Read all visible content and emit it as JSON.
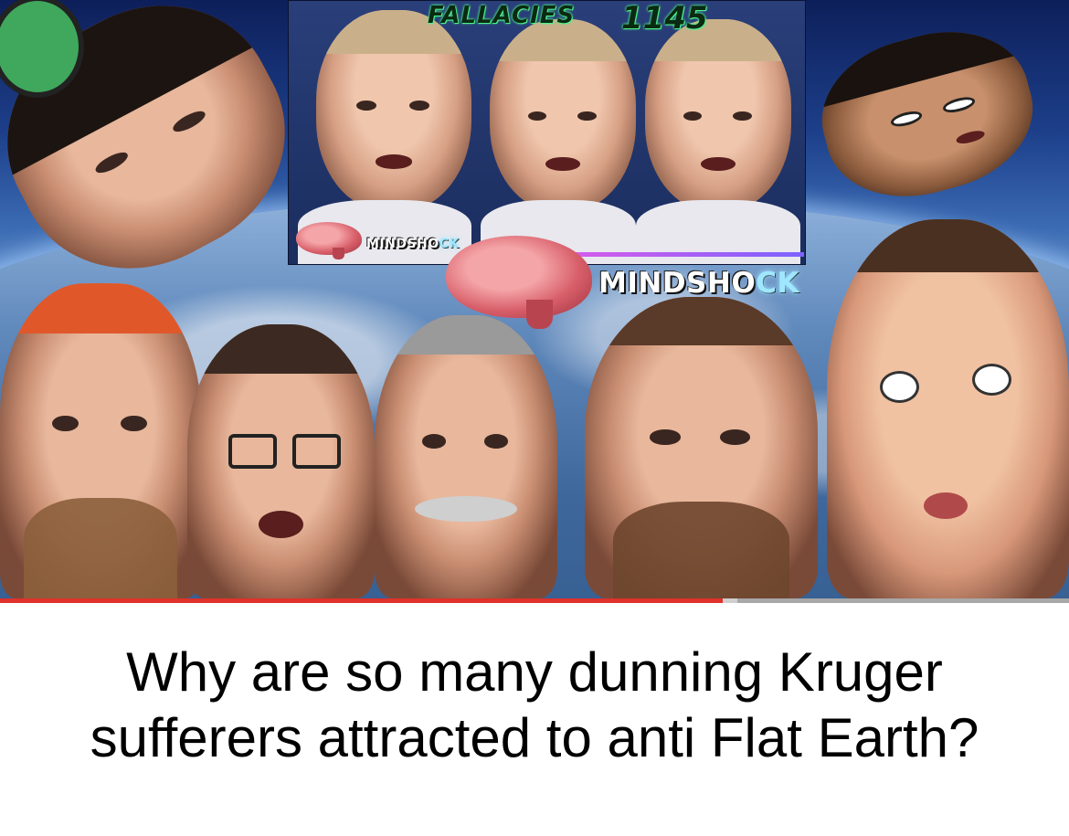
{
  "thumbnail": {
    "overlay_title_left": "FALLACIES",
    "overlay_title_number": "1145",
    "logo_small": {
      "text_main": "MINDSHO",
      "text_glitch": "CK"
    },
    "logo_large": {
      "text_main": "MINDSHO",
      "text_glitch": "CK"
    },
    "accent_colors": {
      "overlay_glow": "#4ef28a",
      "brain": "#d85f6a",
      "logo_bar": "#e05be8"
    }
  },
  "progress": {
    "played_fraction": 0.676,
    "buffered_fraction": 0.69,
    "played_color": "#e0322a"
  },
  "caption": {
    "line1": "Why are so many dunning Kruger",
    "line2": "sufferers attracted to anti Flat Earth?"
  }
}
